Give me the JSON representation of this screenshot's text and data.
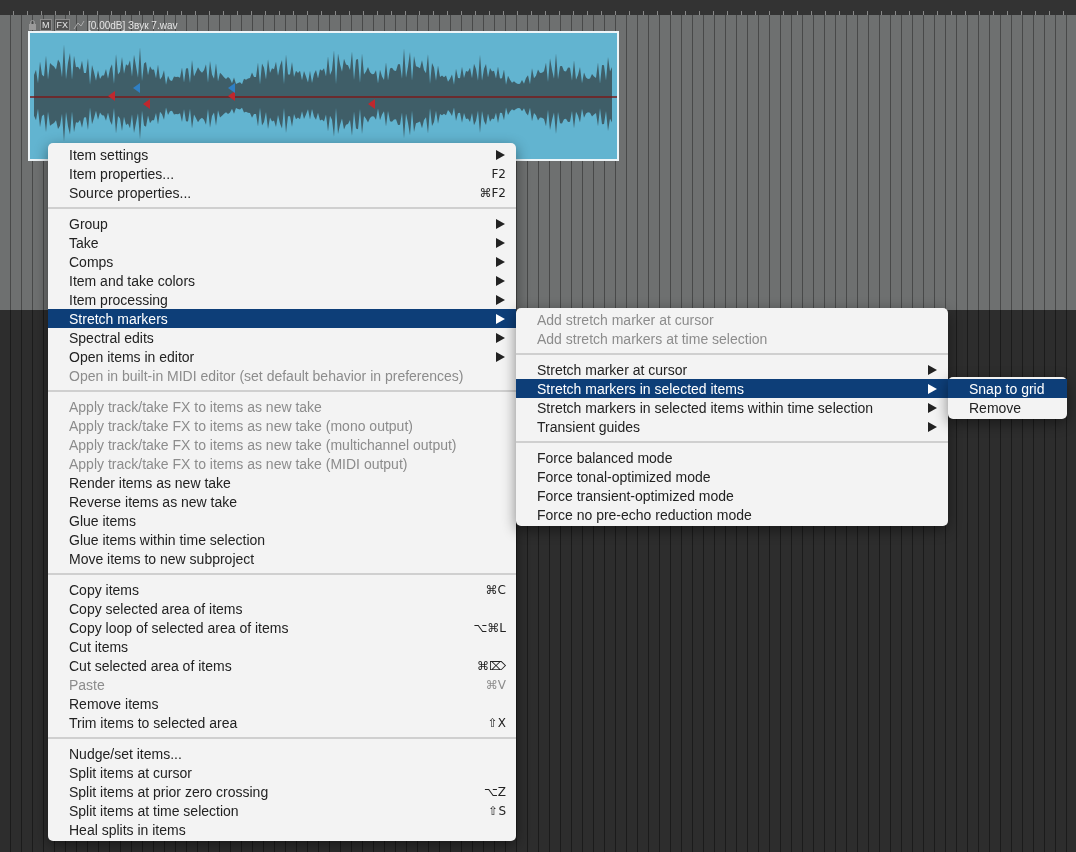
{
  "item": {
    "header": {
      "mute": "M",
      "fx": "FX",
      "title": "[0.00dB] Звук 7.wav"
    }
  },
  "menus": [
    {
      "items": [
        {
          "kind": "item",
          "label": "Item settings",
          "submenu": true,
          "disabled": false,
          "selected": false
        },
        {
          "kind": "item",
          "label": "Item properties...",
          "shortcut": "F2",
          "submenu": false,
          "disabled": false,
          "selected": false
        },
        {
          "kind": "item",
          "label": "Source properties...",
          "shortcut": "⌘F2",
          "submenu": false,
          "disabled": false,
          "selected": false
        },
        {
          "kind": "separator"
        },
        {
          "kind": "item",
          "label": "Group",
          "submenu": true,
          "disabled": false,
          "selected": false
        },
        {
          "kind": "item",
          "label": "Take",
          "submenu": true,
          "disabled": false,
          "selected": false
        },
        {
          "kind": "item",
          "label": "Comps",
          "submenu": true,
          "disabled": false,
          "selected": false
        },
        {
          "kind": "item",
          "label": "Item and take colors",
          "submenu": true,
          "disabled": false,
          "selected": false
        },
        {
          "kind": "item",
          "label": "Item processing",
          "submenu": true,
          "disabled": false,
          "selected": false
        },
        {
          "kind": "item",
          "label": "Stretch markers",
          "submenu": true,
          "disabled": false,
          "selected": true
        },
        {
          "kind": "item",
          "label": "Spectral edits",
          "submenu": true,
          "disabled": false,
          "selected": false
        },
        {
          "kind": "item",
          "label": "Open items in editor",
          "submenu": true,
          "disabled": false,
          "selected": false
        },
        {
          "kind": "item",
          "label": "Open in built-in MIDI editor (set default behavior in preferences)",
          "submenu": false,
          "disabled": true,
          "selected": false
        },
        {
          "kind": "separator"
        },
        {
          "kind": "item",
          "label": "Apply track/take FX to items as new take",
          "submenu": false,
          "disabled": true,
          "selected": false
        },
        {
          "kind": "item",
          "label": "Apply track/take FX to items as new take (mono output)",
          "submenu": false,
          "disabled": true,
          "selected": false
        },
        {
          "kind": "item",
          "label": "Apply track/take FX to items as new take (multichannel output)",
          "submenu": false,
          "disabled": true,
          "selected": false
        },
        {
          "kind": "item",
          "label": "Apply track/take FX to items as new take (MIDI output)",
          "submenu": false,
          "disabled": true,
          "selected": false
        },
        {
          "kind": "item",
          "label": "Render items as new take",
          "submenu": false,
          "disabled": false,
          "selected": false
        },
        {
          "kind": "item",
          "label": "Reverse items as new take",
          "submenu": false,
          "disabled": false,
          "selected": false
        },
        {
          "kind": "item",
          "label": "Glue items",
          "submenu": false,
          "disabled": false,
          "selected": false
        },
        {
          "kind": "item",
          "label": "Glue items within time selection",
          "submenu": false,
          "disabled": false,
          "selected": false
        },
        {
          "kind": "item",
          "label": "Move items to new subproject",
          "submenu": false,
          "disabled": false,
          "selected": false
        },
        {
          "kind": "separator"
        },
        {
          "kind": "item",
          "label": "Copy items",
          "shortcut": "⌘C",
          "submenu": false,
          "disabled": false,
          "selected": false
        },
        {
          "kind": "item",
          "label": "Copy selected area of items",
          "submenu": false,
          "disabled": false,
          "selected": false
        },
        {
          "kind": "item",
          "label": "Copy loop of selected area of items",
          "shortcut": "⌥⌘L",
          "submenu": false,
          "disabled": false,
          "selected": false
        },
        {
          "kind": "item",
          "label": "Cut items",
          "submenu": false,
          "disabled": false,
          "selected": false
        },
        {
          "kind": "item",
          "label": "Cut selected area of items",
          "shortcut": "⌘⌦",
          "submenu": false,
          "disabled": false,
          "selected": false
        },
        {
          "kind": "item",
          "label": "Paste",
          "shortcut": "⌘V",
          "submenu": false,
          "disabled": true,
          "selected": false
        },
        {
          "kind": "item",
          "label": "Remove items",
          "submenu": false,
          "disabled": false,
          "selected": false
        },
        {
          "kind": "item",
          "label": "Trim items to selected area",
          "shortcut": "⇧X",
          "submenu": false,
          "disabled": false,
          "selected": false
        },
        {
          "kind": "separator"
        },
        {
          "kind": "item",
          "label": "Nudge/set items...",
          "submenu": false,
          "disabled": false,
          "selected": false
        },
        {
          "kind": "item",
          "label": "Split items at cursor",
          "submenu": false,
          "disabled": false,
          "selected": false
        },
        {
          "kind": "item",
          "label": "Split items at prior zero crossing",
          "shortcut": "⌥Z",
          "submenu": false,
          "disabled": false,
          "selected": false
        },
        {
          "kind": "item",
          "label": "Split items at time selection",
          "shortcut": "⇧S",
          "submenu": false,
          "disabled": false,
          "selected": false
        },
        {
          "kind": "item",
          "label": "Heal splits in items",
          "submenu": false,
          "disabled": false,
          "selected": false
        }
      ]
    },
    {
      "items": [
        {
          "kind": "item",
          "label": "Add stretch marker at cursor",
          "submenu": false,
          "disabled": true,
          "selected": false
        },
        {
          "kind": "item",
          "label": "Add stretch markers at time selection",
          "submenu": false,
          "disabled": true,
          "selected": false
        },
        {
          "kind": "separator"
        },
        {
          "kind": "item",
          "label": "Stretch marker at cursor",
          "submenu": true,
          "disabled": false,
          "selected": false
        },
        {
          "kind": "item",
          "label": "Stretch markers in selected items",
          "submenu": true,
          "disabled": false,
          "selected": true
        },
        {
          "kind": "item",
          "label": "Stretch markers in selected items within time selection",
          "submenu": true,
          "disabled": false,
          "selected": false
        },
        {
          "kind": "item",
          "label": "Transient guides",
          "submenu": true,
          "disabled": false,
          "selected": false
        },
        {
          "kind": "separator"
        },
        {
          "kind": "item",
          "label": "Force balanced mode",
          "submenu": false,
          "disabled": false,
          "selected": false
        },
        {
          "kind": "item",
          "label": "Force tonal-optimized mode",
          "submenu": false,
          "disabled": false,
          "selected": false
        },
        {
          "kind": "item",
          "label": "Force transient-optimized mode",
          "submenu": false,
          "disabled": false,
          "selected": false
        },
        {
          "kind": "item",
          "label": "Force no pre-echo reduction mode",
          "submenu": false,
          "disabled": false,
          "selected": false
        }
      ]
    },
    {
      "items": [
        {
          "kind": "item",
          "label": "Snap to grid",
          "submenu": false,
          "disabled": false,
          "selected": true
        },
        {
          "kind": "item",
          "label": "Remove",
          "submenu": false,
          "disabled": false,
          "selected": false
        }
      ]
    }
  ]
}
